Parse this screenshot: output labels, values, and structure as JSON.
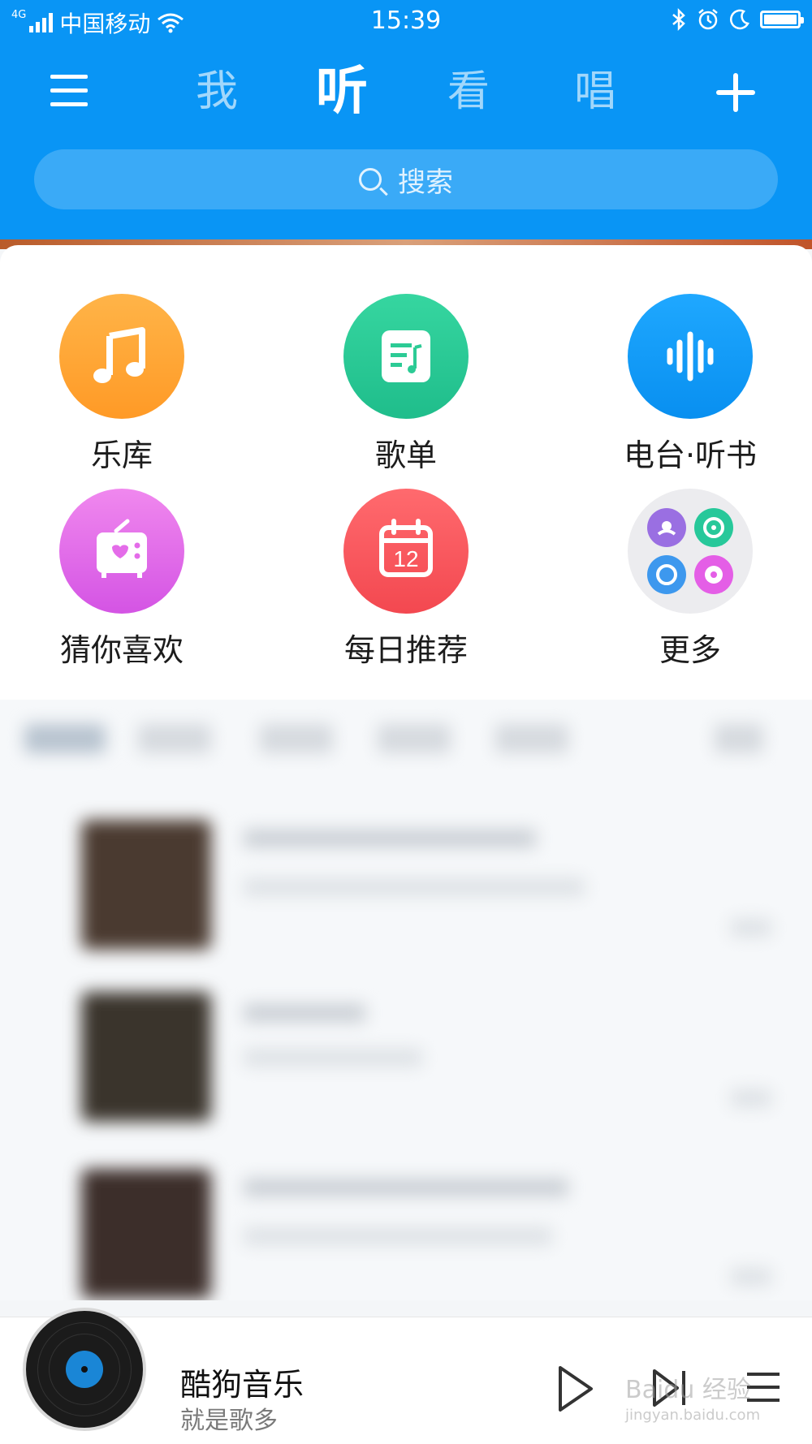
{
  "status_bar": {
    "network": "4G",
    "carrier": "中国移动",
    "time": "15:39",
    "icons": [
      "signal-icon",
      "wifi-icon",
      "bluetooth-icon",
      "alarm-icon",
      "moon-icon",
      "battery-icon"
    ]
  },
  "nav": {
    "tabs": [
      {
        "label": "我",
        "active": false
      },
      {
        "label": "听",
        "active": true
      },
      {
        "label": "看",
        "active": false
      },
      {
        "label": "唱",
        "active": false
      }
    ]
  },
  "search": {
    "placeholder": "搜索"
  },
  "features": [
    {
      "label": "乐库",
      "icon": "music-note-icon",
      "color": "#ffa734"
    },
    {
      "label": "歌单",
      "icon": "playlist-icon",
      "color": "#2ccb95"
    },
    {
      "label": "电台·听书",
      "icon": "sound-wave-icon",
      "color": "#0f9cf8"
    },
    {
      "label": "猜你喜欢",
      "icon": "radio-heart-icon",
      "color": "#e46ce9"
    },
    {
      "label": "每日推荐",
      "icon": "calendar-icon",
      "color": "#f95a5f",
      "calendar_day": "12"
    },
    {
      "label": "更多",
      "icon": "more-apps-icon",
      "color": "#ececef"
    }
  ],
  "player": {
    "title": "酷狗音乐",
    "subtitle": "就是歌多",
    "controls": [
      "play-icon",
      "next-icon",
      "playlist-menu-icon"
    ]
  },
  "watermark": {
    "text": "Baidu 经验",
    "url": "jingyan.baidu.com"
  },
  "colors": {
    "primary": "#0995f5",
    "text": "#1c1c1c",
    "subtext": "#7a7a7a"
  }
}
